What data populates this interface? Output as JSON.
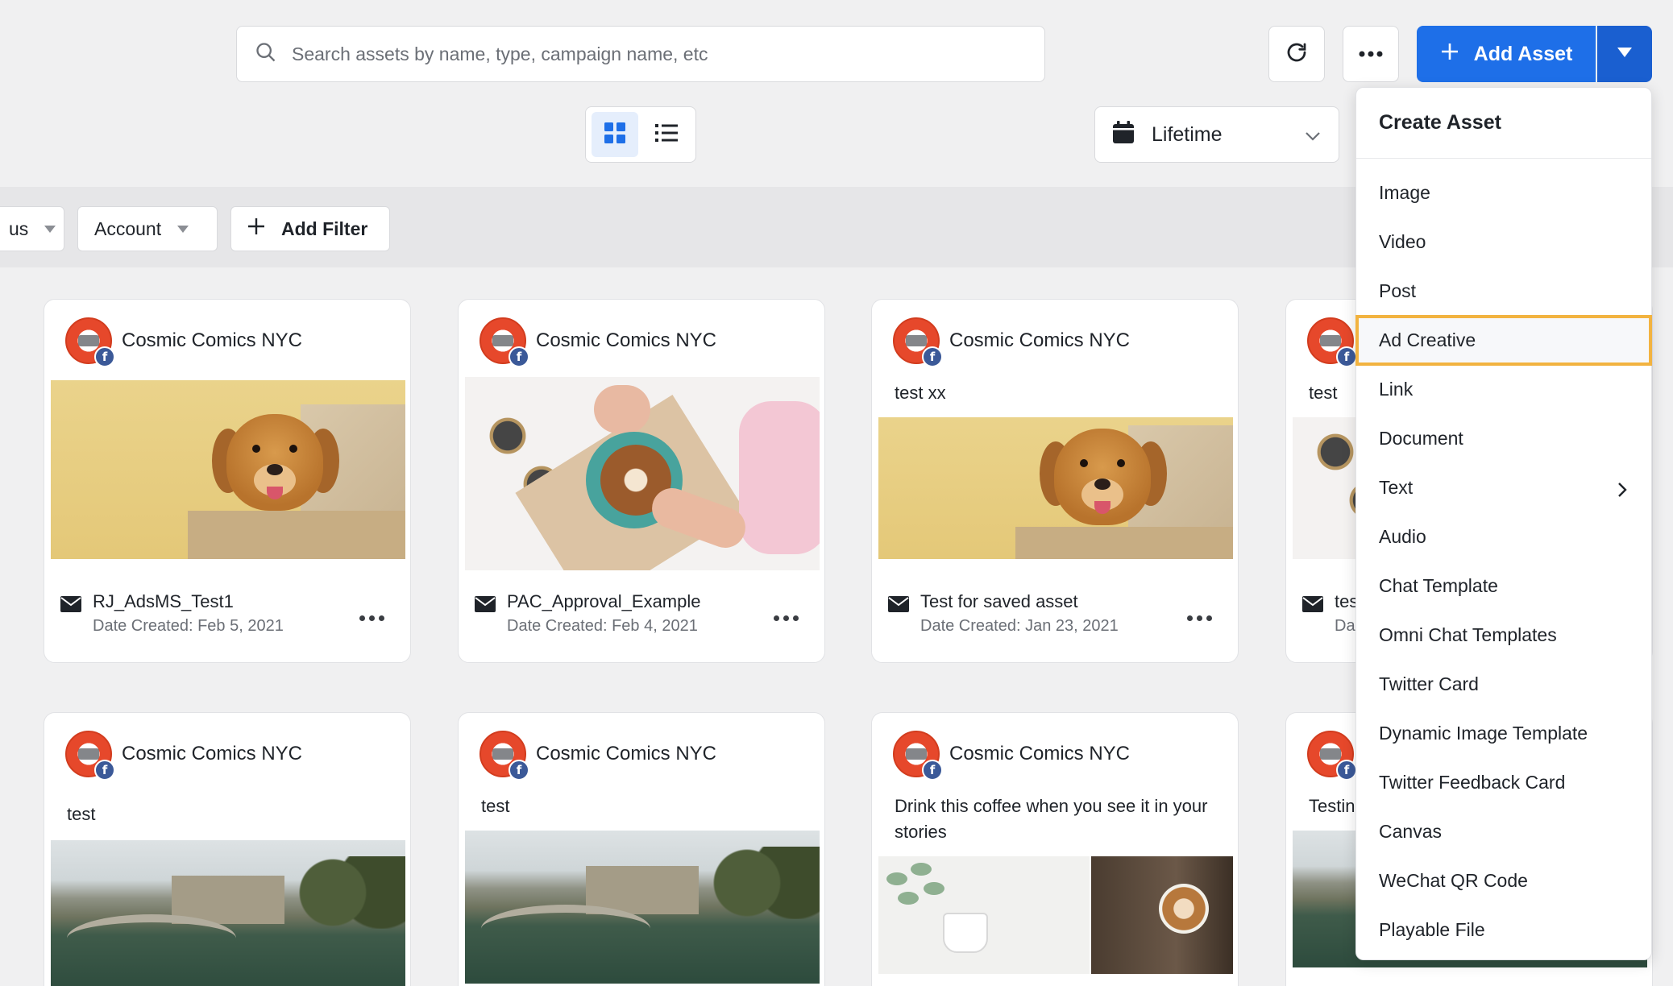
{
  "search": {
    "placeholder": "Search assets by name, type, campaign name, etc"
  },
  "toolbar": {
    "add_label": "Add Asset",
    "icons": [
      "refresh-icon",
      "more-icon",
      "plus-icon",
      "caret-down-icon"
    ]
  },
  "view": {
    "options": [
      "grid-view",
      "list-view"
    ],
    "active": "grid-view"
  },
  "date_filter": {
    "value": "Lifetime"
  },
  "filters": {
    "status_partial": "us",
    "account": "Account",
    "add_filter": "Add Filter"
  },
  "account_name": "Cosmic Comics NYC",
  "cards": [
    {
      "text": "",
      "title": "RJ_AdsMS_Test1",
      "date_label": "Date Created:",
      "date": "Feb 5, 2021"
    },
    {
      "text": "",
      "title": "PAC_Approval_Example",
      "date_label": "Date Created:",
      "date": "Feb 4, 2021"
    },
    {
      "text": "test xx",
      "title": "Test for saved asset",
      "date_label": "Date Created:",
      "date": "Jan 23, 2021"
    },
    {
      "text": "test",
      "title": "tes",
      "date_label": "Da",
      "date": ""
    },
    {
      "text": "test"
    },
    {
      "text": "test"
    },
    {
      "text": "Drink this coffee when you see it in your stories"
    },
    {
      "text": "Testin"
    }
  ],
  "menu": {
    "title": "Create Asset",
    "items": [
      "Image",
      "Video",
      "Post",
      "Ad Creative",
      "Link",
      "Document",
      "Text",
      "Audio",
      "Chat Template",
      "Omni Chat Templates",
      "Twitter Card",
      "Dynamic Image Template",
      "Twitter Feedback Card",
      "Canvas",
      "WeChat QR Code",
      "Playable File"
    ],
    "highlighted": "Ad Creative",
    "has_submenu": "Text"
  },
  "colors": {
    "primary": "#1e6fe8",
    "highlight": "#f2b340",
    "facebook": "#3b5998"
  }
}
